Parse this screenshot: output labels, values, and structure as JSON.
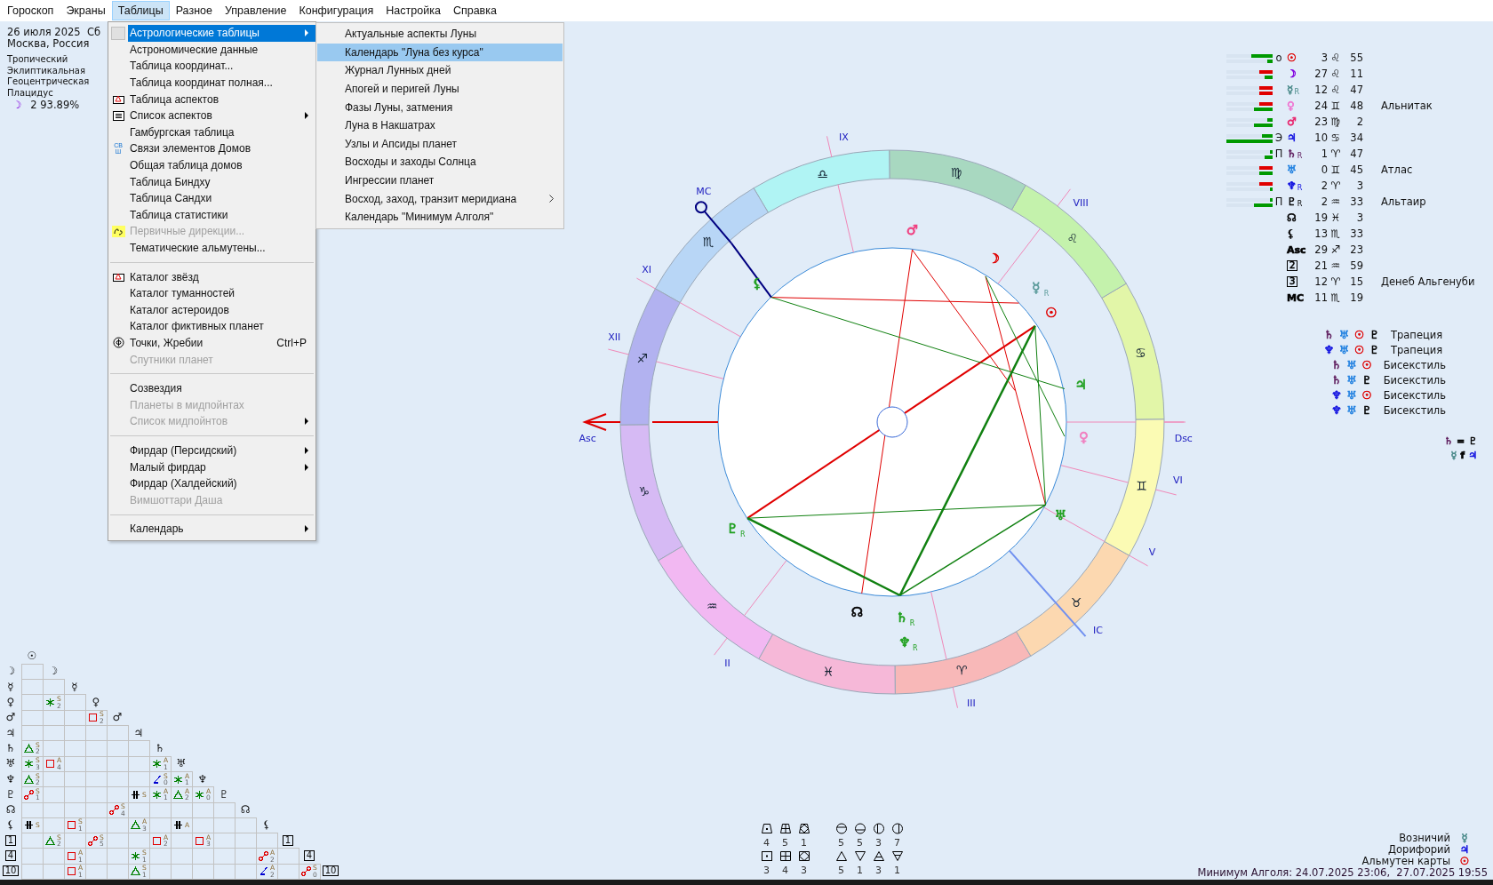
{
  "menubar": [
    {
      "label": "Гороскоп",
      "selected": false
    },
    {
      "label": "Экраны",
      "selected": false
    },
    {
      "label": "Таблицы",
      "selected": true
    },
    {
      "label": "Разное",
      "selected": false
    },
    {
      "label": "Управление",
      "selected": false
    },
    {
      "label": "Конфигурация",
      "selected": false
    },
    {
      "label": "Настройка",
      "selected": false
    },
    {
      "label": "Справка",
      "selected": false
    }
  ],
  "menu": {
    "items": [
      {
        "kind": "item",
        "label": "Астрологические таблицы",
        "selected": true,
        "disabled": false,
        "submenu": true
      },
      {
        "kind": "item",
        "label": "Астрономические данные",
        "selected": false,
        "disabled": false,
        "submenu": false
      },
      {
        "kind": "item",
        "label": "Таблица координат...",
        "selected": false,
        "disabled": false,
        "submenu": false
      },
      {
        "kind": "item",
        "label": "Таблица координат полная...",
        "selected": false,
        "disabled": false,
        "submenu": false
      },
      {
        "kind": "item",
        "label": "Таблица аспектов",
        "selected": false,
        "disabled": false,
        "submenu": false
      },
      {
        "kind": "item",
        "label": "Список аспектов",
        "selected": false,
        "disabled": false,
        "submenu": true
      },
      {
        "kind": "item",
        "label": "Гамбургская таблица",
        "selected": false,
        "disabled": false,
        "submenu": false
      },
      {
        "kind": "item",
        "label": "Связи элементов Домов",
        "selected": false,
        "disabled": false,
        "submenu": false,
        "icon_text": "СВШ"
      },
      {
        "kind": "item",
        "label": "Общая таблица домов",
        "selected": false,
        "disabled": false,
        "submenu": false
      },
      {
        "kind": "item",
        "label": "Таблица Биндху",
        "selected": false,
        "disabled": false,
        "submenu": false
      },
      {
        "kind": "item",
        "label": "Таблица Сандхи",
        "selected": false,
        "disabled": false,
        "submenu": false
      },
      {
        "kind": "item",
        "label": "Таблица статистики",
        "selected": false,
        "disabled": false,
        "submenu": false
      },
      {
        "kind": "item",
        "label": "Первичные дирекции...",
        "selected": false,
        "disabled": true,
        "submenu": false
      },
      {
        "kind": "item",
        "label": "Тематические альмутены...",
        "selected": false,
        "disabled": false,
        "submenu": false
      },
      {
        "kind": "separator"
      },
      {
        "kind": "item",
        "label": "Каталог звёзд",
        "selected": false,
        "disabled": false,
        "submenu": false
      },
      {
        "kind": "item",
        "label": "Каталог туманностей",
        "selected": false,
        "disabled": false,
        "submenu": false
      },
      {
        "kind": "item",
        "label": "Каталог астероидов",
        "selected": false,
        "disabled": false,
        "submenu": false
      },
      {
        "kind": "item",
        "label": "Каталог фиктивных планет",
        "selected": false,
        "disabled": false,
        "submenu": false
      },
      {
        "kind": "item",
        "label": "Точки, Жребии",
        "selected": false,
        "disabled": false,
        "submenu": false,
        "shortcut": "Ctrl+P"
      },
      {
        "kind": "item",
        "label": "Спутники планет",
        "selected": false,
        "disabled": true,
        "submenu": false
      },
      {
        "kind": "separator"
      },
      {
        "kind": "item",
        "label": "Созвездия",
        "selected": false,
        "disabled": false,
        "submenu": false
      },
      {
        "kind": "item",
        "label": "Планеты в мидпойнтах",
        "selected": false,
        "disabled": true,
        "submenu": false
      },
      {
        "kind": "item",
        "label": "Список мидпойнтов",
        "selected": false,
        "disabled": true,
        "submenu": true
      },
      {
        "kind": "separator"
      },
      {
        "kind": "item",
        "label": "Фирдар (Персидский)",
        "selected": false,
        "disabled": false,
        "submenu": true
      },
      {
        "kind": "item",
        "label": "Малый фирдар",
        "selected": false,
        "disabled": false,
        "submenu": true
      },
      {
        "kind": "item",
        "label": "Фирдар (Халдейский)",
        "selected": false,
        "disabled": false,
        "submenu": false
      },
      {
        "kind": "item",
        "label": "Вимшоттари Даша",
        "selected": false,
        "disabled": true,
        "submenu": false
      },
      {
        "kind": "separator"
      },
      {
        "kind": "item",
        "label": "Календарь",
        "selected": false,
        "disabled": false,
        "submenu": true
      }
    ]
  },
  "submenu": {
    "items": [
      {
        "label": "Актуальные аспекты Луны",
        "selected": false,
        "submenu": false
      },
      {
        "label": "Календарь \"Луна без курса\"",
        "selected": true,
        "submenu": false
      },
      {
        "label": "Журнал Лунных дней",
        "selected": false,
        "submenu": false
      },
      {
        "label": "Апогей и перигей Луны",
        "selected": false,
        "submenu": false
      },
      {
        "label": "Фазы Луны, затмения",
        "selected": false,
        "submenu": false
      },
      {
        "label": "Луна в Накшатрах",
        "selected": false,
        "submenu": false
      },
      {
        "label": "Узлы и Апсиды планет",
        "selected": false,
        "submenu": false
      },
      {
        "label": "Восходы и заходы Солнца",
        "selected": false,
        "submenu": false
      },
      {
        "label": "Ингрессии планет",
        "selected": false,
        "submenu": false
      },
      {
        "label": "Восход, заход, транзит меридиана",
        "selected": false,
        "submenu": true
      },
      {
        "label": "Календарь \"Минимум Алголя\"",
        "selected": false,
        "submenu": false
      }
    ]
  },
  "info": {
    "date": "26 июля 2025  Сб",
    "place": "Москва, Россия",
    "settings": [
      "Тропический",
      "Эклиптикальная",
      "Геоцентрическая",
      "Плацидус"
    ],
    "moon_phase": {
      "glyph": "☽",
      "text": "2 93.89%"
    }
  },
  "aspect_grid": {
    "header": "☉",
    "rows": [
      {
        "label": "☽",
        "glyph": "☽",
        "kind": "planet",
        "cells": [
          {}
        ]
      },
      {
        "label": "☿",
        "glyph": "☿",
        "kind": "planet",
        "cells": [
          {},
          {}
        ]
      },
      {
        "label": "♀",
        "glyph": "♀",
        "kind": "planet",
        "cells": [
          {},
          {
            "kind": "sextile",
            "color": "#008000",
            "mode": "S",
            "orb": "2"
          },
          {}
        ]
      },
      {
        "label": "♂",
        "glyph": "♂",
        "kind": "planet",
        "cells": [
          {},
          {},
          {},
          {
            "kind": "square",
            "color": "#e00000",
            "mode": "S",
            "orb": "2"
          }
        ]
      },
      {
        "label": "♃",
        "glyph": "♃",
        "kind": "planet",
        "cells": [
          {},
          {},
          {},
          {},
          {}
        ]
      },
      {
        "label": "♄",
        "glyph": "♄",
        "kind": "planet",
        "cells": [
          {
            "kind": "trine",
            "color": "#008000",
            "mode": "S",
            "orb": "2"
          },
          {},
          {},
          {},
          {},
          {}
        ]
      },
      {
        "label": "♅",
        "glyph": "♅",
        "kind": "planet",
        "cells": [
          {
            "kind": "sextile",
            "color": "#008000",
            "mode": "S",
            "orb": "3"
          },
          {
            "kind": "square",
            "color": "#e00000",
            "mode": "A",
            "orb": "4"
          },
          {},
          {},
          {},
          {},
          {
            "kind": "sextile",
            "color": "#008000",
            "mode": "A",
            "orb": "1"
          }
        ]
      },
      {
        "label": "♆",
        "glyph": "♆",
        "kind": "planet",
        "cells": [
          {
            "kind": "trine",
            "color": "#008000",
            "mode": "S",
            "orb": "2"
          },
          {},
          {},
          {},
          {},
          {},
          {
            "kind": "quincunx",
            "color": "#0000d0",
            "mode": "S",
            "orb": "0"
          },
          {
            "kind": "sextile",
            "color": "#008000",
            "mode": "A",
            "orb": "1"
          }
        ]
      },
      {
        "label": "♇",
        "glyph": "♇",
        "kind": "planet",
        "cells": [
          {
            "kind": "opposition",
            "color": "#e00000",
            "mode": "S",
            "orb": "1"
          },
          {},
          {},
          {},
          {},
          {
            "kind": "parallel",
            "color": "#000000",
            "mode": "S"
          },
          {
            "kind": "sextile",
            "color": "#008000",
            "mode": "A",
            "orb": "1"
          },
          {
            "kind": "trine",
            "color": "#008000",
            "mode": "A",
            "orb": "2"
          },
          {
            "kind": "sextile",
            "color": "#008000",
            "mode": "A",
            "orb": "0"
          }
        ]
      },
      {
        "label": "☊",
        "glyph": "☊",
        "kind": "planet",
        "cells": [
          {},
          {},
          {},
          {},
          {
            "kind": "opposition",
            "color": "#e00000",
            "mode": "S",
            "orb": "4"
          },
          {},
          {},
          {},
          {},
          {}
        ]
      },
      {
        "label": "⚸",
        "glyph": "⚸",
        "kind": "planet",
        "cells": [
          {
            "kind": "parallel",
            "color": "#000000",
            "mode": "S"
          },
          {},
          {
            "kind": "square",
            "color": "#e00000",
            "mode": "S",
            "orb": "1"
          },
          {},
          {},
          {
            "kind": "trine",
            "color": "#008000",
            "mode": "A",
            "orb": "3"
          },
          {},
          {
            "kind": "parallel",
            "color": "#000000",
            "mode": "A"
          },
          {},
          {},
          {}
        ]
      },
      {
        "label": "1",
        "glyph": "1",
        "kind": "house",
        "cells": [
          {},
          {
            "kind": "trine",
            "color": "#008000",
            "mode": "S",
            "orb": "2"
          },
          {},
          {
            "kind": "opposition",
            "color": "#e00000",
            "mode": "S",
            "orb": "5"
          },
          {},
          {},
          {
            "kind": "square",
            "color": "#e00000",
            "mode": "A",
            "orb": "2"
          },
          {},
          {
            "kind": "square",
            "color": "#e00000",
            "mode": "A",
            "orb": "3"
          },
          {},
          {},
          {}
        ]
      },
      {
        "label": "4",
        "glyph": "4",
        "kind": "house",
        "cells": [
          {},
          {},
          {
            "kind": "square",
            "color": "#e00000",
            "mode": "A",
            "orb": "1"
          },
          {},
          {},
          {
            "kind": "sextile",
            "color": "#008000",
            "mode": "S",
            "orb": "1"
          },
          {},
          {},
          {},
          {},
          {},
          {
            "kind": "opposition",
            "color": "#e00000",
            "mode": "A",
            "orb": "2"
          },
          {}
        ]
      },
      {
        "label": "10",
        "glyph": "10",
        "kind": "house",
        "cells": [
          {},
          {},
          {
            "kind": "square",
            "color": "#e00000",
            "mode": "A",
            "orb": "1"
          },
          {},
          {},
          {
            "kind": "trine",
            "color": "#008000",
            "mode": "S",
            "orb": "1"
          },
          {},
          {},
          {},
          {},
          {},
          {
            "kind": "quincunx",
            "color": "#0000d0",
            "mode": "A",
            "orb": "2"
          },
          {},
          {
            "kind": "opposition",
            "color": "#e00000",
            "mode": "S",
            "orb": "0"
          }
        ]
      }
    ]
  },
  "wheel": {
    "signs": [
      {
        "glyph": "♈",
        "color": "#f8b8b8"
      },
      {
        "glyph": "♉",
        "color": "#fcd8b0"
      },
      {
        "glyph": "♊",
        "color": "#fbfbb4"
      },
      {
        "glyph": "♋",
        "color": "#e2f6a8"
      },
      {
        "glyph": "♌",
        "color": "#c4f2ac"
      },
      {
        "glyph": "♍",
        "color": "#a8d8c0"
      },
      {
        "glyph": "♎",
        "color": "#b0f4f4"
      },
      {
        "glyph": "♏",
        "color": "#b8d6f6"
      },
      {
        "glyph": "♐",
        "color": "#b2b2f0"
      },
      {
        "glyph": "♑",
        "color": "#d6baf4"
      },
      {
        "glyph": "♒",
        "color": "#f2b8f2"
      },
      {
        "glyph": "♓",
        "color": "#f6b8d8"
      }
    ],
    "houses": [
      {
        "label": "Asc"
      },
      {
        "label": "II"
      },
      {
        "label": "III"
      },
      {
        "label": "IC"
      },
      {
        "label": "V"
      },
      {
        "label": "VI"
      },
      {
        "label": "Dsc"
      },
      {
        "label": "VIII"
      },
      {
        "label": "IX"
      },
      {
        "label": "MC"
      },
      {
        "label": "XI"
      },
      {
        "label": "XII"
      }
    ],
    "planets": [
      {
        "glyph": "☉",
        "color": "#e00000"
      },
      {
        "glyph": "☽",
        "color": "#e00000"
      },
      {
        "glyph": "☿",
        "color": "#5a9a9a",
        "retro": "R"
      },
      {
        "glyph": "♀",
        "color": "#f080c0"
      },
      {
        "glyph": "♂",
        "color": "#f04080"
      },
      {
        "glyph": "♃",
        "color": "#20a020"
      },
      {
        "glyph": "♄",
        "color": "#20a020",
        "retro": "R"
      },
      {
        "glyph": "♅",
        "color": "#20a020"
      },
      {
        "glyph": "♆",
        "color": "#20a020",
        "retro": "R"
      },
      {
        "glyph": "♇",
        "color": "#20a020",
        "retro": "R"
      },
      {
        "glyph": "☊",
        "color": "#000000"
      },
      {
        "glyph": "⚸",
        "color": "#20a020"
      }
    ]
  },
  "element_counts": [
    [
      {
        "kind": "trap-dot",
        "count": "4"
      },
      {
        "kind": "trap-grid",
        "count": "5"
      },
      {
        "kind": "trap-diamond",
        "count": "1"
      },
      {
        "kind": "circle-top",
        "count": "5"
      },
      {
        "kind": "circle-bottom",
        "count": "5"
      },
      {
        "kind": "circle-left",
        "count": "3"
      },
      {
        "kind": "circle-right",
        "count": "7"
      }
    ],
    [
      {
        "kind": "square-dot",
        "count": "3"
      },
      {
        "kind": "square-grid",
        "count": "4"
      },
      {
        "kind": "square-diamond",
        "count": "3"
      },
      {
        "kind": "tri-up",
        "count": "5"
      },
      {
        "kind": "tri-down",
        "count": "1"
      },
      {
        "kind": "tri-up-bar",
        "count": "3"
      },
      {
        "kind": "tri-down-bar",
        "count": "1"
      }
    ]
  ],
  "positions": [
    {
      "kind": "planet",
      "bars": [
        {
          "color": "#009900",
          "level": 0.46
        },
        {
          "color": "#009900",
          "level": 0.12
        }
      ],
      "dignity": "о",
      "glyph": "☉",
      "color": "#e00000",
      "deg": "3",
      "sign": "♌",
      "min": "55"
    },
    {
      "kind": "planet",
      "bars": [
        {
          "color": "#e00000",
          "level": 0.29
        },
        {
          "color": "#009900",
          "level": 0.17
        }
      ],
      "glyph": "☽",
      "color": "#8000e0",
      "deg": "27",
      "sign": "♌",
      "min": "11"
    },
    {
      "kind": "planet",
      "bars": [
        {
          "color": "#e00000",
          "level": 0.29
        },
        {
          "color": "#e00000",
          "level": 0.29
        }
      ],
      "glyph": "☿",
      "color": "#4a8a8a",
      "retro": "R",
      "deg": "12",
      "sign": "♌",
      "min": "47"
    },
    {
      "kind": "planet",
      "bars": [
        {
          "color": "#e00000",
          "level": 0.29
        },
        {
          "color": "#009900",
          "level": 0.4
        }
      ],
      "glyph": "♀",
      "color": "#f070d0",
      "deg": "24",
      "sign": "♊",
      "min": "48",
      "star": "Альнитак"
    },
    {
      "kind": "planet",
      "bars": [
        {
          "color": "#009900",
          "level": 0.12
        },
        {
          "color": "#009900",
          "level": 0.4
        }
      ],
      "glyph": "♂",
      "color": "#e8206a",
      "deg": "23",
      "sign": "♍",
      "min": "2"
    },
    {
      "kind": "planet",
      "bars": [
        {
          "color": "#009900",
          "level": 0.23
        },
        {
          "color": "#009900",
          "level": 1
        }
      ],
      "dignity": "Э",
      "glyph": "♃",
      "color": "#1010e0",
      "deg": "10",
      "sign": "♋",
      "min": "34"
    },
    {
      "kind": "planet",
      "bars": [
        {
          "color": "#009900",
          "level": 0.06
        },
        {
          "color": "#009900",
          "level": 0.17
        }
      ],
      "dignity": "П",
      "glyph": "♄",
      "color": "#602060",
      "retro": "R",
      "deg": "1",
      "sign": "♈",
      "min": "47"
    },
    {
      "kind": "planet",
      "bars": [
        {
          "color": "#e00000",
          "level": 0.29
        },
        {
          "color": "#009900",
          "level": 0.29
        }
      ],
      "glyph": "♅",
      "color": "#2080e0",
      "deg": "0",
      "sign": "♊",
      "min": "45",
      "star": "Атлас"
    },
    {
      "kind": "planet",
      "bars": [
        {
          "color": "#e00000",
          "level": 0.29
        },
        {
          "color": "#009900",
          "level": 0.06
        }
      ],
      "glyph": "♆",
      "color": "#1010e0",
      "retro": "R",
      "deg": "2",
      "sign": "♈",
      "min": "3"
    },
    {
      "kind": "planet",
      "bars": [
        {
          "color": "#009900",
          "level": 0.06
        },
        {
          "color": "#009900",
          "level": 0.4
        }
      ],
      "dignity": "П",
      "glyph": "♇",
      "color": "#000000",
      "retro": "R",
      "deg": "2",
      "sign": "♒",
      "min": "33",
      "star": "Альтаир"
    },
    {
      "kind": "planet",
      "glyph": "☊",
      "color": "#000000",
      "deg": "19",
      "sign": "♓",
      "min": "3"
    },
    {
      "kind": "planet",
      "glyph": "⚸",
      "color": "#000000",
      "deg": "13",
      "sign": "♏",
      "min": "33"
    },
    {
      "kind": "point",
      "glyph": "Asc",
      "color": "#000000",
      "deg": "29",
      "sign": "♐",
      "min": "23"
    },
    {
      "kind": "house",
      "glyph": "2",
      "color": "#000000",
      "deg": "21",
      "sign": "♒",
      "min": "59"
    },
    {
      "kind": "house",
      "glyph": "3",
      "color": "#000000",
      "deg": "12",
      "sign": "♈",
      "min": "15",
      "star": "Денеб Альгенуби"
    },
    {
      "kind": "point",
      "glyph": "MC",
      "color": "#000000",
      "deg": "11",
      "sign": "♏",
      "min": "19"
    }
  ],
  "patterns": [
    {
      "glyphs": [
        {
          "g": "♄",
          "color": "#602060"
        },
        {
          "g": "♅",
          "color": "#2080e0"
        },
        {
          "g": "☉",
          "color": "#e00000"
        },
        {
          "g": "♇",
          "color": "#000000"
        }
      ],
      "name": "Трапеция"
    },
    {
      "glyphs": [
        {
          "g": "♆",
          "color": "#1010e0"
        },
        {
          "g": "♅",
          "color": "#2080e0"
        },
        {
          "g": "☉",
          "color": "#e00000"
        },
        {
          "g": "♇",
          "color": "#000000"
        }
      ],
      "name": "Трапеция"
    },
    {
      "glyphs": [
        {
          "g": "♄",
          "color": "#602060"
        },
        {
          "g": "♅",
          "color": "#2080e0"
        },
        {
          "g": "☉",
          "color": "#e00000"
        }
      ],
      "name": "Бисекстиль"
    },
    {
      "glyphs": [
        {
          "g": "♄",
          "color": "#602060"
        },
        {
          "g": "♅",
          "color": "#2080e0"
        },
        {
          "g": "♇",
          "color": "#000000"
        }
      ],
      "name": "Бисекстиль"
    },
    {
      "glyphs": [
        {
          "g": "♆",
          "color": "#1010e0"
        },
        {
          "g": "♅",
          "color": "#2080e0"
        },
        {
          "g": "☉",
          "color": "#e00000"
        }
      ],
      "name": "Бисекстиль"
    },
    {
      "glyphs": [
        {
          "g": "♆",
          "color": "#1010e0"
        },
        {
          "g": "♅",
          "color": "#2080e0"
        },
        {
          "g": "♇",
          "color": "#000000"
        }
      ],
      "name": "Бисекстиль"
    }
  ],
  "legend": [
    {
      "parts": [
        {
          "g": "♄",
          "color": "#602060"
        },
        {
          "g": "=",
          "color": "#000000"
        },
        {
          "g": "♇",
          "color": "#000000"
        }
      ]
    },
    {
      "parts": [
        {
          "g": "☿",
          "color": "#4a8a8a"
        },
        {
          "g": "f",
          "color": "#000000"
        },
        {
          "g": "♃",
          "color": "#1010e0"
        }
      ]
    }
  ],
  "summary": [
    {
      "label": "Возничий",
      "glyph": "☿",
      "color": "#4a8a8a"
    },
    {
      "label": "Дорифорий",
      "glyph": "♃",
      "color": "#1010e0"
    },
    {
      "label": "Альмутен карты",
      "glyph": "☉",
      "color": "#e00000"
    }
  ],
  "algol": "Минимум Алголя: 24.07.2025 23:06,  27.07.2025 19:55"
}
